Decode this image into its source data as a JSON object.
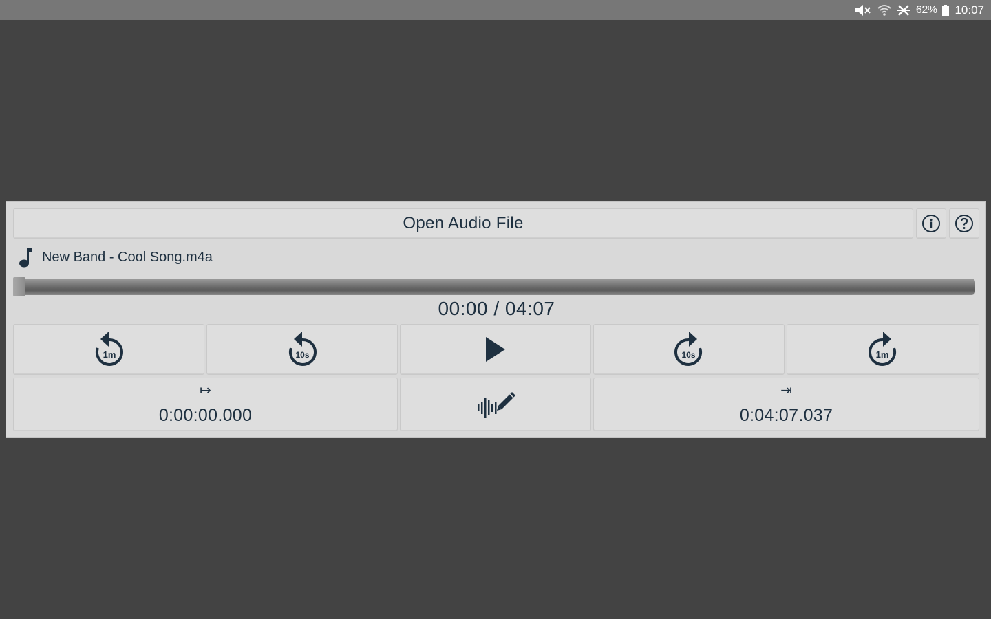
{
  "status_bar": {
    "battery": "62%",
    "time": "10:07",
    "icons": [
      "mute-icon",
      "wifi-icon",
      "airplane-mode-icon",
      "battery-icon"
    ]
  },
  "player": {
    "open_file_label": "Open Audio File",
    "file_name": "New Band - Cool Song.m4a",
    "time_display": "00:00 / 04:07",
    "progress": 0.0,
    "controls": {
      "rewind_1m": "1m",
      "rewind_10s": "10s",
      "forward_10s": "10s",
      "forward_1m": "1m"
    },
    "start_marker": {
      "arrow": "↦",
      "time": "0:00:00.000"
    },
    "end_marker": {
      "arrow": "⇥",
      "time": "0:04:07.037"
    }
  },
  "colors": {
    "background": "#434343",
    "status_bar": "#777777",
    "panel": "#d9d9d9",
    "icon": "#1e3040"
  }
}
